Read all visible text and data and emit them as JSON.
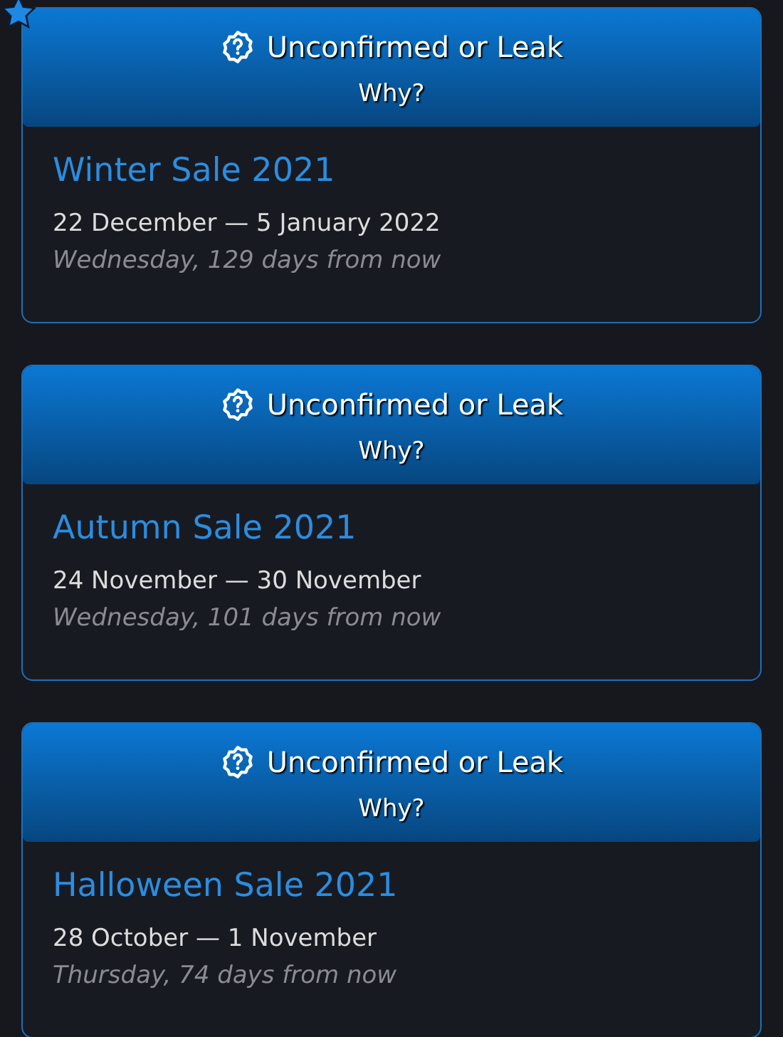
{
  "sales": [
    {
      "starred": true,
      "status": "Unconfirmed or Leak",
      "why": "Why?",
      "title": "Winter Sale 2021",
      "dates": "22 December — 5 January 2022",
      "relative": "Wednesday, 129 days from now"
    },
    {
      "starred": false,
      "status": "Unconfirmed or Leak",
      "why": "Why?",
      "title": "Autumn Sale 2021",
      "dates": "24 November — 30 November",
      "relative": "Wednesday, 101 days from now"
    },
    {
      "starred": false,
      "status": "Unconfirmed or Leak",
      "why": "Why?",
      "title": "Halloween Sale 2021",
      "dates": "28 October — 1 November",
      "relative": "Thursday, 74 days from now"
    }
  ]
}
